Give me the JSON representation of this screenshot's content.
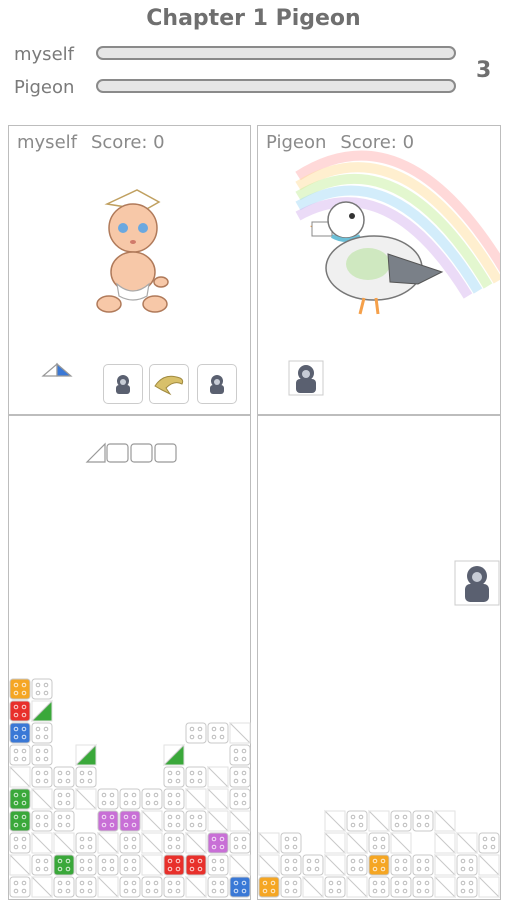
{
  "header": {
    "title": "Chapter 1 Pigeon",
    "round": "3"
  },
  "players": [
    {
      "name": "myself",
      "progress": 0.0
    },
    {
      "name": "Pigeon",
      "progress": 0.0
    }
  ],
  "panels": [
    {
      "name": "myself",
      "score_label": "Score: 0",
      "character": "baby-character",
      "items": [
        "gorilla-icon",
        "dolphin-icon",
        "gorilla-icon"
      ]
    },
    {
      "name": "Pigeon",
      "score_label": "Score: 0",
      "character": "pigeon-character",
      "items": [
        "gorilla-icon"
      ]
    }
  ],
  "colors": {
    "orange": "#f5a623",
    "red": "#e8302b",
    "green": "#3aa83a",
    "blue": "#3a78d6",
    "purple": "#c86fd6",
    "empty": "#ffffff",
    "border": "#c8c8c8"
  },
  "boards": {
    "myself": [
      "...........",
      "Ow.........",
      "Rg.........",
      "Bw......wwt",
      "ww.g...g..w",
      "twww...wwtw",
      "Gtwtwwwwttw",
      "Gww.PPtwwtt",
      "wttwtwtwtPw",
      "twGwwwtRRwt",
      "wtwwtwwwtwB"
    ],
    "pigeon": [
      "...........",
      "...........",
      "...........",
      "...........",
      "...........",
      "...........",
      "...........",
      "...twtwwt..",
      "tw.ttwt.ttw",
      "twwtwOwwtwt",
      "Owtwtwwwtwt"
    ]
  }
}
